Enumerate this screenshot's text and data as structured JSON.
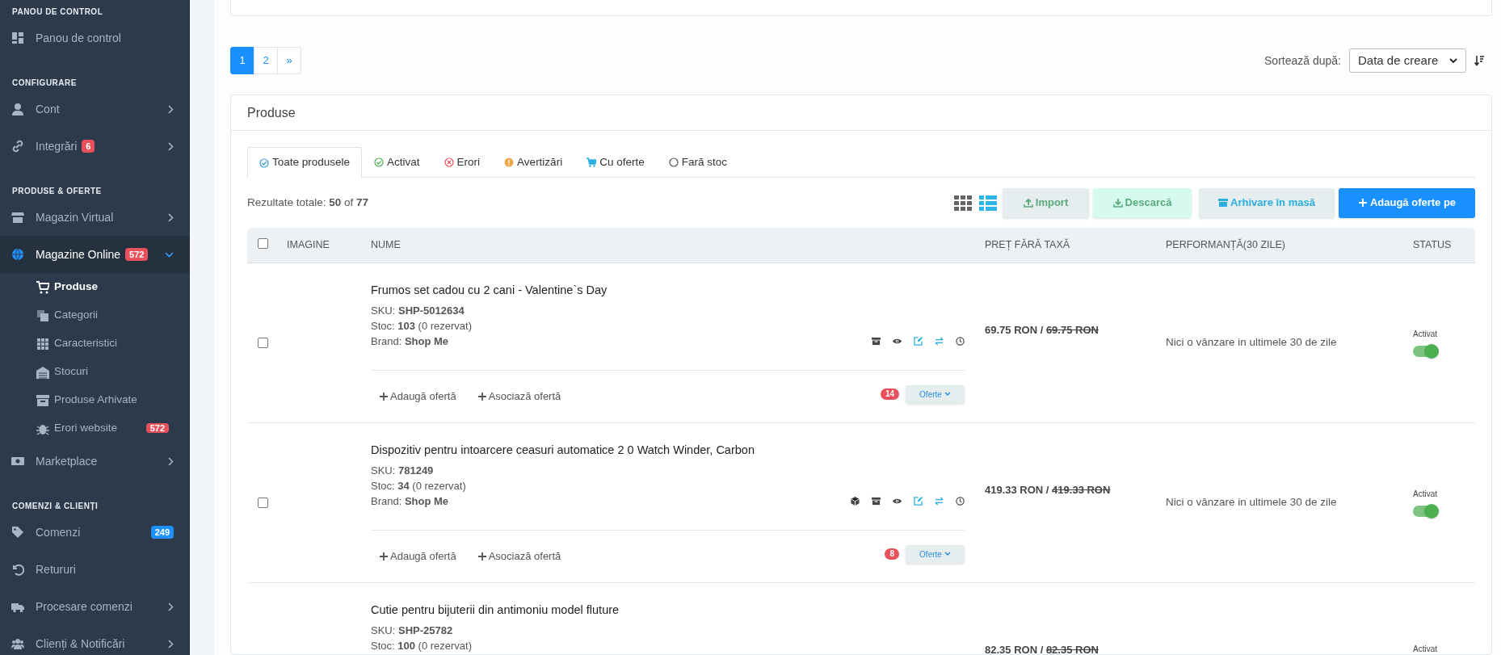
{
  "sidebar": {
    "items": [
      {
        "kind": "header",
        "label": "PANOU DE CONTROL"
      },
      {
        "kind": "item",
        "label": "Panou de control",
        "selected": false
      },
      {
        "kind": "header",
        "label": "CONFIGURARE"
      },
      {
        "kind": "item",
        "label": "Cont",
        "selected": false,
        "expanded": false
      },
      {
        "kind": "item",
        "label": "Integrări",
        "selected": false,
        "expanded": false,
        "badge": "6",
        "color": "#e8505b"
      },
      {
        "kind": "header",
        "label": "PRODUSE & OFERTE"
      },
      {
        "kind": "item",
        "label": "Magazin Virtual",
        "selected": false,
        "expanded": false
      },
      {
        "kind": "item",
        "label": "Magazine Online",
        "selected": true,
        "expanded": true,
        "badge": "572",
        "color": "#e8505b"
      },
      {
        "kind": "subitem",
        "label": "Produse",
        "selected": true
      },
      {
        "kind": "subitem",
        "label": "Categorii",
        "selected": false
      },
      {
        "kind": "subitem",
        "label": "Caracteristici",
        "selected": false
      },
      {
        "kind": "subitem",
        "label": "Stocuri",
        "selected": false
      },
      {
        "kind": "subitem",
        "label": "Produse Arhivate",
        "selected": false
      },
      {
        "kind": "subitem",
        "label": "Erori website",
        "selected": false,
        "badge": "572",
        "color": "#e8505b"
      },
      {
        "kind": "item",
        "label": "Marketplace",
        "selected": false,
        "expanded": false
      },
      {
        "kind": "header",
        "label": "COMENZI & CLIENȚI"
      },
      {
        "kind": "item",
        "label": "Comenzi",
        "selected": false,
        "badge": "249",
        "color": "#1e90ff"
      },
      {
        "kind": "item",
        "label": "Retururi",
        "selected": false
      },
      {
        "kind": "item",
        "label": "Procesare comenzi",
        "selected": false,
        "expanded": false
      },
      {
        "kind": "item",
        "label": "Clienți & Notificări",
        "selected": false,
        "expanded": false
      }
    ]
  },
  "pagination": [
    {
      "label": "1",
      "selected": true
    },
    {
      "label": "2",
      "selected": false
    },
    {
      "label": "»",
      "selected": false
    }
  ],
  "sort": {
    "label": "Sortează după:",
    "value": "Data de creare"
  },
  "panel": {
    "title": "Produse",
    "tabs": [
      {
        "label": "Toate produsele",
        "selected": true
      },
      {
        "label": "Activat",
        "selected": false
      },
      {
        "label": "Erori",
        "selected": false
      },
      {
        "label": "Avertizări",
        "selected": false
      },
      {
        "label": "Cu oferte",
        "selected": false
      },
      {
        "label": "Fară stoc",
        "selected": false
      }
    ],
    "results": "Rezultate totale: **50** of **77**",
    "views": [
      {
        "selected": false
      },
      {
        "selected": true
      }
    ],
    "buttons": [
      "Import",
      "Descarcă",
      "Arhivare în masă",
      "Adaugă oferte pe"
    ],
    "table": {
      "select_all": false,
      "columns": [
        "IMAGINE",
        "NUME",
        "PREȚ FĂRĂ TAXĂ",
        "PERFORMANȚĂ(30 ZILE)",
        "STATUS"
      ],
      "rows": [
        {
          "checked": false,
          "name": "Frumos set cadou cu 2 cani - Valentine`s Day",
          "sku": "SKU: **SHP-5012634**",
          "stock": "Stoc: **103** (0 rezervat)",
          "brand": "Brand: **Shop Me**",
          "has_package_action": false,
          "add_offer": "Adaugă ofertă",
          "associate_offer": "Asociază ofertă",
          "offer_count": "14",
          "offers_button": "Oferte",
          "price": "69.75 RON / ",
          "list_price": "69.75 RON",
          "performance": "Nici o vânzare in ultimele 30 de zile",
          "status_label": "Activat",
          "on": true
        },
        {
          "checked": false,
          "name": "Dispozitiv pentru intoarcere ceasuri automatice 2 0  Watch Winder, Carbon",
          "sku": "SKU: **781249**",
          "stock": "Stoc: **34** (0 rezervat)",
          "brand": "Brand: **Shop Me**",
          "has_package_action": true,
          "add_offer": "Adaugă ofertă",
          "associate_offer": "Asociază ofertă",
          "offer_count": "8",
          "offers_button": "Oferte",
          "price": "419.33 RON / ",
          "list_price": "419.33 RON",
          "performance": "Nici o vânzare in ultimele 30 de zile",
          "status_label": "Activat",
          "on": true
        },
        {
          "name": "Cutie pentru bijuterii din antimoniu model fluture",
          "sku": "SKU: **SHP-25782**",
          "stock": "Stoc: **100** (0 rezervat)",
          "price": "82.35 RON / ",
          "list_price": "82.35 RON",
          "status_label": "Activat"
        }
      ]
    }
  }
}
